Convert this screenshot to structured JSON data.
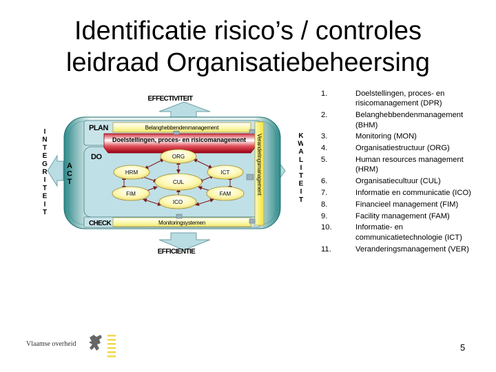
{
  "title": {
    "line1": "Identificatie risico’s / controles",
    "line2": "leidraad Organisatiebeheersing"
  },
  "diagram": {
    "top_arrow_label": "EFFECTIVITEIT",
    "bottom_arrow_label": "EFFICIENTIE",
    "left_vertical_label": [
      "I",
      "N",
      "T",
      "E",
      "G",
      "R",
      "I",
      "T",
      "E",
      "I",
      "T"
    ],
    "right_vertical_label": [
      "K",
      "W",
      "A",
      "L",
      "I",
      "T",
      "E",
      "I",
      "T"
    ],
    "act_label": [
      "A",
      "C",
      "T"
    ],
    "plan_label": "PLAN",
    "do_label": "DO",
    "check_label": "CHECK",
    "plan_bar": "Belanghebbendenmanagement",
    "red_banner": "Doelstellingen, proces- en risicomanagement",
    "check_bar": "Monitoringsystemen",
    "side_bar": "Veranderingsmanagement",
    "nodes": {
      "org": "ORG",
      "hrm": "HRM",
      "ict": "ICT",
      "cul": "CUL",
      "fim": "FIM",
      "fam": "FAM",
      "ico": "ICO"
    },
    "colors": {
      "frame": "#2f8a8a",
      "panel": "#bfe0e6",
      "yellow": "#fdf9a8",
      "red": "#c8102e",
      "arrow_fill": "#b9dde2"
    }
  },
  "list": [
    {
      "num": "1.",
      "text": "Doelstellingen, proces- en risicomanagement (DPR)"
    },
    {
      "num": "2.",
      "text": "Belanghebbendenmanagement (BHM)"
    },
    {
      "num": "3.",
      "text": "Monitoring (MON)"
    },
    {
      "num": "4.",
      "text": "Organisatiestructuur (ORG)"
    },
    {
      "num": "5.",
      "text": "Human resources management (HRM)"
    },
    {
      "num": "6.",
      "text": "Organisatiecultuur (CUL)"
    },
    {
      "num": "7.",
      "text": "Informatie en communicatie (ICO)"
    },
    {
      "num": "8.",
      "text": "Financieel management (FIM)"
    },
    {
      "num": "9.",
      "text": "Facility management (FAM)"
    },
    {
      "num": "10.",
      "text": "Informatie- en communicatietechnologie (ICT)"
    },
    {
      "num": "11.",
      "text": "Veranderingsmanagement (VER)"
    }
  ],
  "footer": {
    "logo_text": "Vlaamse overheid",
    "page_number": "5"
  }
}
